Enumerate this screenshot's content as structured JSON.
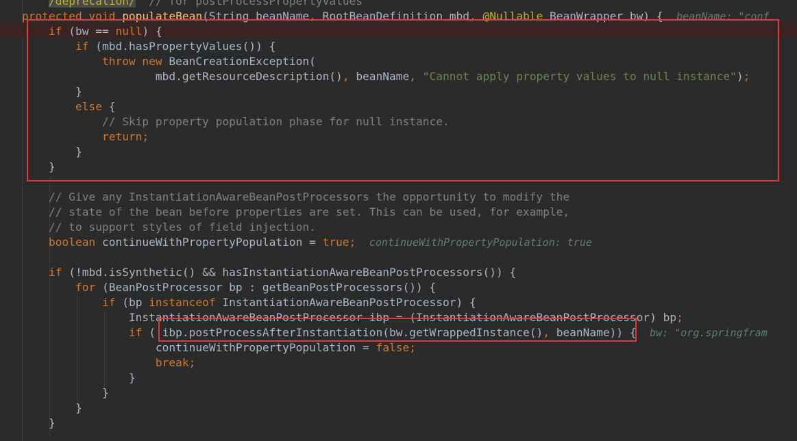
{
  "editor": {
    "lines": [
      {
        "indent": "    ",
        "tokens": [
          {
            "t": "/deprecation/",
            "c": "an ann-bg"
          },
          {
            "t": "  ",
            "c": ""
          },
          {
            "t": "// for postProcessPropertyValues",
            "c": "cm"
          }
        ]
      },
      {
        "indent": "",
        "tokens": [
          {
            "t": "protected void ",
            "c": "kw"
          },
          {
            "t": "populateBean",
            "c": "fn"
          },
          {
            "t": "(String beanName",
            "c": ""
          },
          {
            "t": ", ",
            "c": "kw"
          },
          {
            "t": "RootBeanDefinition mbd",
            "c": ""
          },
          {
            "t": ", ",
            "c": "kw"
          },
          {
            "t": "@Nullable ",
            "c": "an"
          },
          {
            "t": "BeanWrapper bw) {  ",
            "c": ""
          },
          {
            "t": "beanName: \"conf",
            "c": "ht"
          }
        ]
      },
      {
        "indent": "    ",
        "tokens": [
          {
            "t": "if ",
            "c": "kw"
          },
          {
            "t": "(bw == ",
            "c": ""
          },
          {
            "t": "null",
            "c": "kw"
          },
          {
            "t": ") {",
            "c": ""
          }
        ]
      },
      {
        "indent": "        ",
        "tokens": [
          {
            "t": "if ",
            "c": "kw"
          },
          {
            "t": "(mbd.hasPropertyValues()) {",
            "c": ""
          }
        ]
      },
      {
        "indent": "            ",
        "tokens": [
          {
            "t": "throw new ",
            "c": "kw"
          },
          {
            "t": "BeanCreationException(",
            "c": ""
          }
        ]
      },
      {
        "indent": "                    ",
        "tokens": [
          {
            "t": "mbd.getResourceDescription()",
            "c": ""
          },
          {
            "t": ", ",
            "c": "kw"
          },
          {
            "t": "beanName",
            "c": ""
          },
          {
            "t": ", ",
            "c": "kw"
          },
          {
            "t": "\"Cannot apply property values to null instance\"",
            "c": "st"
          },
          {
            "t": ")",
            "c": ""
          },
          {
            "t": ";",
            "c": "kw"
          }
        ]
      },
      {
        "indent": "        ",
        "tokens": [
          {
            "t": "}",
            "c": ""
          }
        ]
      },
      {
        "indent": "        ",
        "tokens": [
          {
            "t": "else ",
            "c": "kw"
          },
          {
            "t": "{",
            "c": ""
          }
        ]
      },
      {
        "indent": "            ",
        "tokens": [
          {
            "t": "// Skip property population phase for null instance.",
            "c": "cm"
          }
        ]
      },
      {
        "indent": "            ",
        "tokens": [
          {
            "t": "return;",
            "c": "kw"
          }
        ]
      },
      {
        "indent": "        ",
        "tokens": [
          {
            "t": "}",
            "c": ""
          }
        ]
      },
      {
        "indent": "    ",
        "tokens": [
          {
            "t": "}",
            "c": ""
          }
        ]
      },
      {
        "indent": "",
        "tokens": []
      },
      {
        "indent": "    ",
        "tokens": [
          {
            "t": "// Give any InstantiationAwareBeanPostProcessors the opportunity to modify the",
            "c": "cm"
          }
        ]
      },
      {
        "indent": "    ",
        "tokens": [
          {
            "t": "// state of the bean before properties are set. This can be used, for example,",
            "c": "cm"
          }
        ]
      },
      {
        "indent": "    ",
        "tokens": [
          {
            "t": "// to support styles of field injection.",
            "c": "cm"
          }
        ]
      },
      {
        "indent": "    ",
        "tokens": [
          {
            "t": "boolean ",
            "c": "kw"
          },
          {
            "t": "continueWithPropertyPopulation = ",
            "c": ""
          },
          {
            "t": "true;",
            "c": "kw"
          },
          {
            "t": "  ",
            "c": ""
          },
          {
            "t": "continueWithPropertyPopulation: true",
            "c": "ht"
          }
        ]
      },
      {
        "indent": "",
        "tokens": []
      },
      {
        "indent": "    ",
        "tokens": [
          {
            "t": "if ",
            "c": "kw"
          },
          {
            "t": "(!mbd.isSynthetic() && hasInstantiationAwareBeanPostProcessors()) {",
            "c": ""
          }
        ]
      },
      {
        "indent": "        ",
        "tokens": [
          {
            "t": "for ",
            "c": "kw"
          },
          {
            "t": "(BeanPostProcessor bp : getBeanPostProcessors()) {",
            "c": ""
          }
        ]
      },
      {
        "indent": "            ",
        "tokens": [
          {
            "t": "if ",
            "c": "kw"
          },
          {
            "t": "(bp ",
            "c": ""
          },
          {
            "t": "instanceof ",
            "c": "kw"
          },
          {
            "t": "InstantiationAwareBeanPostProcessor) {",
            "c": ""
          }
        ]
      },
      {
        "indent": "                ",
        "tokens": [
          {
            "t": "InstantiationAwareBeanPostProcessor ibp = (InstantiationAwareBeanPostProcessor) bp",
            "c": ""
          },
          {
            "t": ";",
            "c": "kw"
          }
        ]
      },
      {
        "indent": "                ",
        "tokens": [
          {
            "t": "if ",
            "c": "kw"
          },
          {
            "t": "(!ibp.postProcessAfterInstantiation(bw.getWrappedInstance()",
            "c": ""
          },
          {
            "t": ", ",
            "c": "kw"
          },
          {
            "t": "beanName)) {  ",
            "c": ""
          },
          {
            "t": "bw: \"org.springfram",
            "c": "ht"
          }
        ]
      },
      {
        "indent": "                    ",
        "tokens": [
          {
            "t": "continueWithPropertyPopulation = ",
            "c": ""
          },
          {
            "t": "false;",
            "c": "kw"
          }
        ]
      },
      {
        "indent": "                    ",
        "tokens": [
          {
            "t": "break;",
            "c": "kw"
          }
        ]
      },
      {
        "indent": "                ",
        "tokens": [
          {
            "t": "}",
            "c": ""
          }
        ]
      },
      {
        "indent": "            ",
        "tokens": [
          {
            "t": "}",
            "c": ""
          }
        ]
      },
      {
        "indent": "        ",
        "tokens": [
          {
            "t": "}",
            "c": ""
          }
        ]
      },
      {
        "indent": "    ",
        "tokens": [
          {
            "t": "}",
            "c": ""
          }
        ]
      }
    ]
  }
}
